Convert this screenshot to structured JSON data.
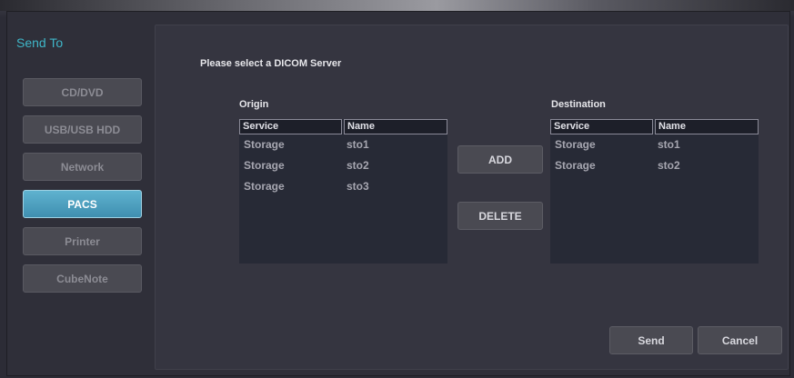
{
  "dialog": {
    "title": "Send To"
  },
  "sidebar": {
    "items": [
      {
        "label": "CD/DVD",
        "active": false
      },
      {
        "label": "USB/USB HDD",
        "active": false
      },
      {
        "label": "Network",
        "active": false
      },
      {
        "label": "PACS",
        "active": true
      },
      {
        "label": "Printer",
        "active": false
      },
      {
        "label": "CubeNote",
        "active": false
      }
    ]
  },
  "main": {
    "prompt": "Please select a DICOM Server",
    "origin": {
      "label": "Origin",
      "headers": [
        "Service",
        "Name"
      ],
      "rows": [
        {
          "service": "Storage",
          "name": "sto1"
        },
        {
          "service": "Storage",
          "name": "sto2"
        },
        {
          "service": "Storage",
          "name": "sto3"
        }
      ]
    },
    "destination": {
      "label": "Destination",
      "headers": [
        "Service",
        "Name"
      ],
      "rows": [
        {
          "service": "Storage",
          "name": "sto1"
        },
        {
          "service": "Storage",
          "name": "sto2"
        }
      ]
    },
    "add_label": "ADD",
    "delete_label": "DELETE"
  },
  "footer": {
    "send_label": "Send",
    "cancel_label": "Cancel"
  },
  "colors": {
    "accent": "#3fb6c8",
    "active_button": "#4fa2c2"
  }
}
